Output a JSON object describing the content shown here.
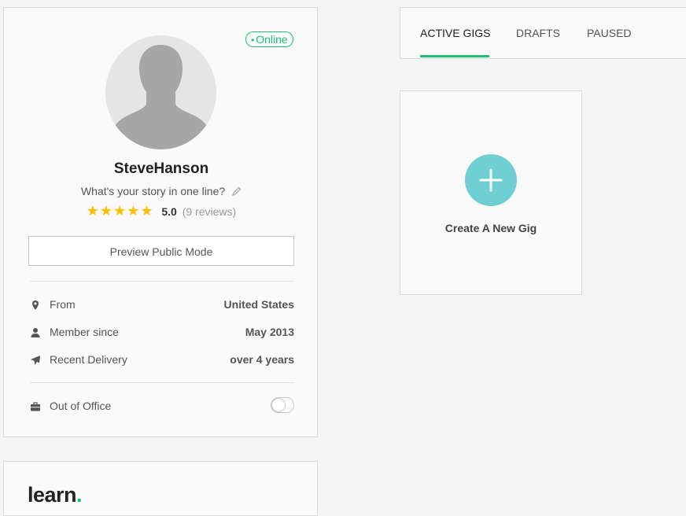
{
  "profile": {
    "status": "Online",
    "username": "SteveHanson",
    "tagline": "What's your story in one line?",
    "stars": 5,
    "rating": "5.0",
    "reviews": "(9 reviews)",
    "preview_button": "Preview Public Mode",
    "info": [
      {
        "icon": "map-pin-icon",
        "label": "From",
        "value": "United States"
      },
      {
        "icon": "user-icon",
        "label": "Member since",
        "value": "May 2013"
      },
      {
        "icon": "paper-plane-icon",
        "label": "Recent Delivery",
        "value": "over 4 years"
      }
    ],
    "out_of_office": {
      "icon": "briefcase-icon",
      "label": "Out of Office",
      "enabled": false
    }
  },
  "learn": {
    "logo": "learn",
    "logo_dot": "."
  },
  "tabs": [
    {
      "label": "ACTIVE GIGS",
      "active": true
    },
    {
      "label": "DRAFTS",
      "active": false
    },
    {
      "label": "PAUSED",
      "active": false
    }
  ],
  "create_gig": {
    "label": "Create A New Gig"
  },
  "colors": {
    "accent": "#1dbf73",
    "plus_circle": "#6fcfd3",
    "star": "#ffbf00"
  }
}
